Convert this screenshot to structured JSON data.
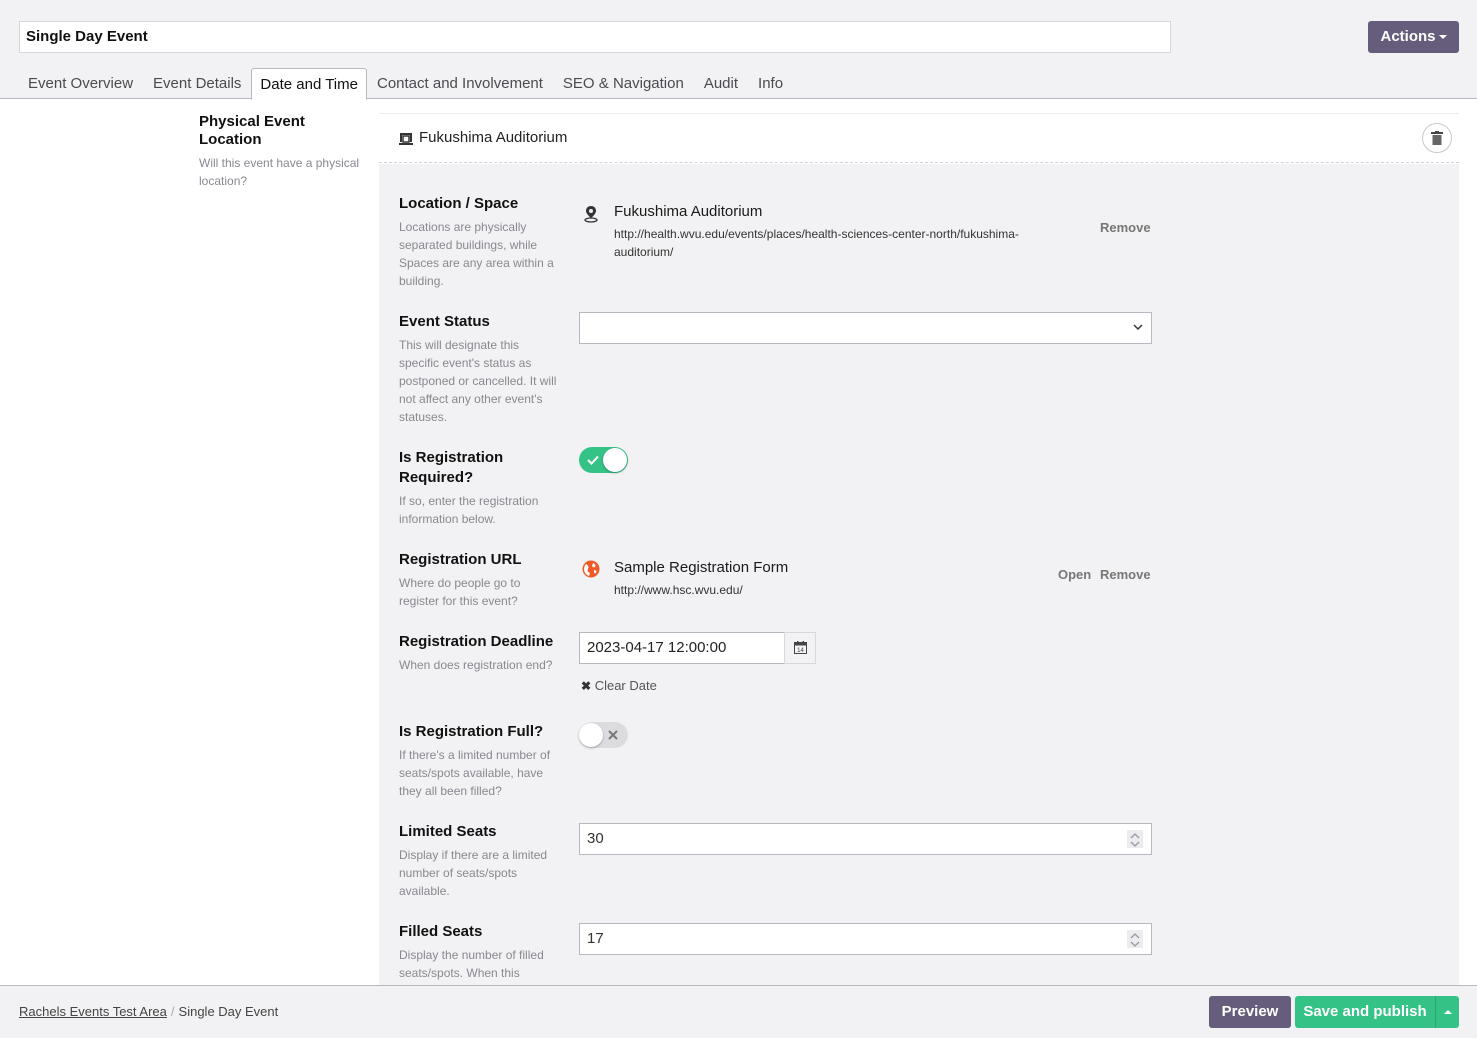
{
  "header": {
    "event_title": "Single Day Event",
    "actions_label": "Actions"
  },
  "tabs": [
    {
      "label": "Event Overview",
      "active": false
    },
    {
      "label": "Event Details",
      "active": false
    },
    {
      "label": "Date and Time",
      "active": true
    },
    {
      "label": "Contact and Involvement",
      "active": false
    },
    {
      "label": "SEO & Navigation",
      "active": false
    },
    {
      "label": "Audit",
      "active": false
    },
    {
      "label": "Info",
      "active": false
    }
  ],
  "section": {
    "title": "Physical Event Location",
    "description": "Will this event have a physical location?"
  },
  "card": {
    "title": "Fukushima Auditorium",
    "icon": "building-icon",
    "delete_icon": "trash-icon"
  },
  "fields": {
    "location": {
      "label": "Location / Space",
      "description": "Locations are physically separated buildings, while Spaces are any area within a building.",
      "value_title": "Fukushima Auditorium",
      "value_url": "http://health.wvu.edu/events/places/health-sciences-center-north/fukushima-auditorium/",
      "remove_label": "Remove",
      "icon": "map-pin-icon"
    },
    "event_status": {
      "label": "Event Status",
      "description": "This will designate this specific event's status as postponed or cancelled. It will not affect any other event's statuses.",
      "selected": ""
    },
    "registration_required": {
      "label": "Is Registration Required?",
      "description": "If so, enter the registration information below.",
      "value": true
    },
    "registration_url": {
      "label": "Registration URL",
      "description": "Where do people go to register for this event?",
      "value_title": "Sample Registration Form",
      "value_url": "http://www.hsc.wvu.edu/",
      "open_label": "Open",
      "remove_label": "Remove",
      "icon": "globe-icon",
      "icon_color": "#f05a28"
    },
    "registration_deadline": {
      "label": "Registration Deadline",
      "description": "When does registration end?",
      "value": "2023-04-17 12:00:00",
      "clear_label": "Clear Date"
    },
    "registration_full": {
      "label": "Is Registration Full?",
      "description": "If there's a limited number of seats/spots available, have they all been filled?",
      "value": false
    },
    "limited_seats": {
      "label": "Limited Seats",
      "description": "Display if there are a limited number of seats/spots available.",
      "value": "30"
    },
    "filled_seats": {
      "label": "Filled Seats",
      "description": "Display the number of filled seats/spots. When this",
      "value": "17"
    }
  },
  "footer": {
    "breadcrumb_parent": "Rachels Events Test Area",
    "breadcrumb_separator": "/",
    "breadcrumb_current": "Single Day Event",
    "preview_label": "Preview",
    "publish_label": "Save and publish"
  },
  "colors": {
    "primary_purple": "#655d7b",
    "success_green": "#35c286",
    "panel_gray": "#f2f2f4"
  }
}
